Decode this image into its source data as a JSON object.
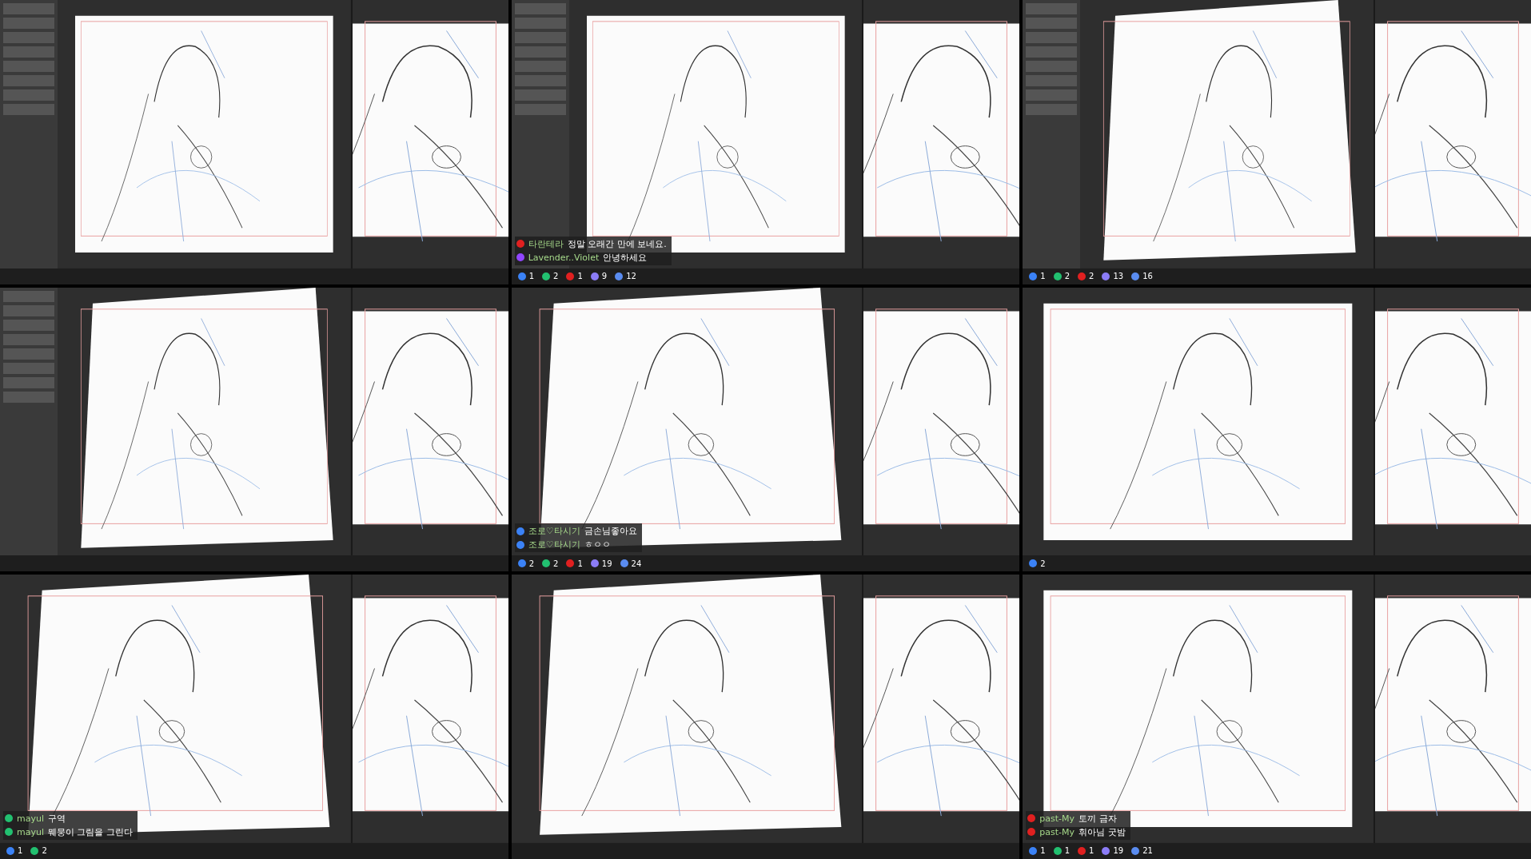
{
  "frames": [
    {
      "left_panel": true,
      "canvas_tilted": false
    },
    {
      "left_panel": true,
      "canvas_tilted": false,
      "chat": [
        {
          "kind": "youtube",
          "name": "타란테라",
          "message": "정말 오래간 만에 보네요."
        },
        {
          "kind": "twitch",
          "name": "Lavender..Violet",
          "message": "안녕하세요"
        }
      ],
      "stats": [
        {
          "kind": "chain",
          "value": "1"
        },
        {
          "kind": "person",
          "value": "2"
        },
        {
          "kind": "play",
          "value": "1"
        },
        {
          "kind": "chat",
          "value": "9"
        },
        {
          "kind": "eye",
          "value": "12"
        }
      ]
    },
    {
      "left_panel": true,
      "canvas_tilted": true,
      "stats": [
        {
          "kind": "chain",
          "value": "1"
        },
        {
          "kind": "person",
          "value": "2"
        },
        {
          "kind": "play",
          "value": "2"
        },
        {
          "kind": "chat",
          "value": "13"
        },
        {
          "kind": "eye",
          "value": "16"
        }
      ]
    },
    {
      "left_panel": true,
      "canvas_tilted": true
    },
    {
      "canvas_tilted": true,
      "chat": [
        {
          "kind": "chain",
          "name": "조로♡타시기",
          "message": "금손님좋아요"
        },
        {
          "kind": "chain",
          "name": "조로♡타시기",
          "message": "ㅎㅇㅇ"
        }
      ],
      "stats": [
        {
          "kind": "chain",
          "value": "2"
        },
        {
          "kind": "person",
          "value": "2"
        },
        {
          "kind": "play",
          "value": "1"
        },
        {
          "kind": "chat",
          "value": "19"
        },
        {
          "kind": "eye",
          "value": "24"
        }
      ]
    },
    {
      "canvas_tilted": false,
      "stats": [
        {
          "kind": "chain",
          "value": "2"
        }
      ]
    },
    {
      "canvas_tilted": true,
      "chat": [
        {
          "kind": "chzzk",
          "name": "mayul",
          "message": "구역"
        },
        {
          "kind": "chzzk",
          "name": "mayul",
          "message": "뭬뭉이 그림을 그린다"
        }
      ],
      "stats": [
        {
          "kind": "chain",
          "value": "1"
        },
        {
          "kind": "person",
          "value": "2"
        }
      ]
    },
    {
      "canvas_tilted": true
    },
    {
      "canvas_tilted": false,
      "chat": [
        {
          "kind": "youtube",
          "name": "past-My",
          "message": "토끼 금자"
        },
        {
          "kind": "youtube",
          "name": "past-My",
          "message": "휘아님 굿밤"
        }
      ],
      "stats": [
        {
          "kind": "chain",
          "value": "1"
        },
        {
          "kind": "person",
          "value": "1"
        },
        {
          "kind": "play",
          "value": "1"
        },
        {
          "kind": "chat",
          "value": "19"
        },
        {
          "kind": "eye",
          "value": "21"
        }
      ]
    }
  ]
}
